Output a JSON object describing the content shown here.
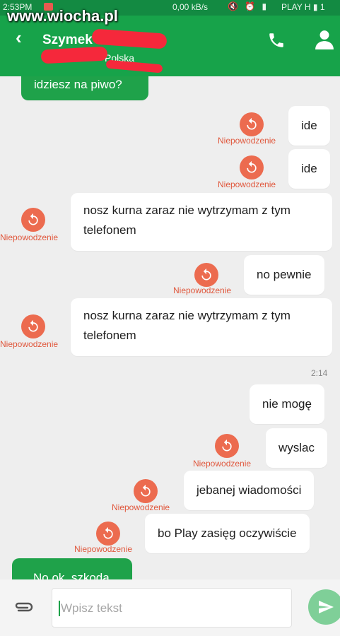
{
  "status_bar": {
    "time": "2:53PM",
    "net_speed": "0,00 kB/s",
    "icons": "🔇 ⏰ ▮",
    "carrier": "PLAY H ▮ 1",
    "color": "#138a42"
  },
  "watermark": "www.wiocha.pl",
  "header": {
    "back_icon": "‹",
    "contact_name": "Szymek",
    "subtitle": "Polska",
    "color": "#17a34a",
    "call_icon": "phone-icon",
    "profile_icon": "person-icon"
  },
  "failed_label": "Niepowodzenie",
  "timestamp": "2:14",
  "messages": [
    {
      "text": "idziesz na piwo?",
      "side": "incoming",
      "status": "sent"
    },
    {
      "text": "ide",
      "side": "outgoing",
      "status": "failed"
    },
    {
      "text": "ide",
      "side": "outgoing",
      "status": "failed"
    },
    {
      "text": "nosz kurna zaraz nie wytrzymam z tym telefonem",
      "side": "outgoing",
      "status": "failed"
    },
    {
      "text": "no pewnie",
      "side": "outgoing",
      "status": "failed"
    },
    {
      "text": "nosz kurna zaraz nie wytrzymam z tym telefonem",
      "side": "outgoing",
      "status": "failed"
    },
    {
      "text": "nie mogę",
      "side": "outgoing",
      "status": "sent"
    },
    {
      "text": "wyslac",
      "side": "outgoing",
      "status": "failed"
    },
    {
      "text": "jebanej wiadomości",
      "side": "outgoing",
      "status": "failed"
    },
    {
      "text": "bo Play zasięg oczywiście",
      "side": "outgoing",
      "status": "failed"
    },
    {
      "text": "No ok, szkoda",
      "side": "incoming",
      "status": "sent"
    }
  ],
  "composer": {
    "placeholder": "Wpisz tekst",
    "attach_icon": "paperclip-icon",
    "send_icon": "send-icon"
  }
}
